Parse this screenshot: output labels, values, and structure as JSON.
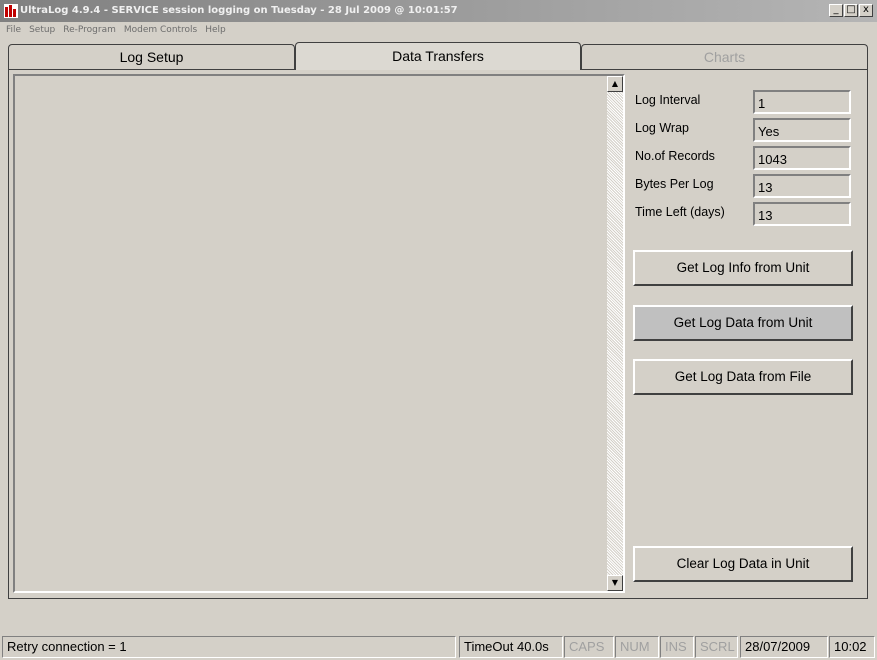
{
  "window": {
    "title": "UltraLog 4.9.4 - SERVICE session logging on Tuesday - 28 Jul 2009 @ 10:01:57",
    "icon": "app-icon",
    "buttons": {
      "minimize": "_",
      "maximize": "□",
      "close": "x"
    }
  },
  "menu": [
    "File",
    "Setup",
    "Re-Program",
    "Modem Controls",
    "Help"
  ],
  "tabs": [
    {
      "label": "Log Setup",
      "state": "inactive"
    },
    {
      "label": "Data Transfers",
      "state": "active"
    },
    {
      "label": "Charts",
      "state": "disabled"
    }
  ],
  "log_info": [
    {
      "label": "Log Interval",
      "value": "1"
    },
    {
      "label": "Log Wrap",
      "value": "Yes"
    },
    {
      "label": "No.of Records",
      "value": "1043"
    },
    {
      "label": "Bytes Per Log",
      "value": "13"
    },
    {
      "label": "Time Left (days)",
      "value": "13"
    }
  ],
  "buttons": {
    "get_log_info": "Get Log Info from Unit",
    "get_log_data_unit": "Get Log Data from Unit",
    "get_log_data_file": "Get Log Data from File",
    "clear_log_data": "Clear Log Data in Unit"
  },
  "status": {
    "message": "Retry connection = 1",
    "timeout": "TimeOut 40.0s",
    "caps": "CAPS",
    "num": "NUM",
    "ins": "INS",
    "scrl": "SCRL",
    "date": "28/07/2009",
    "time": "10:02"
  }
}
